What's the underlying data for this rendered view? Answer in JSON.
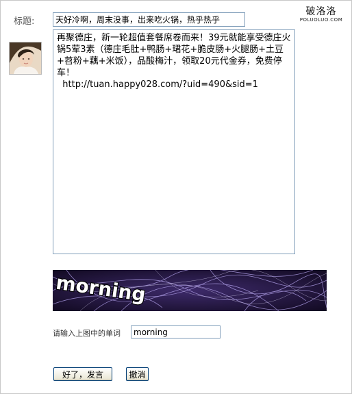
{
  "form": {
    "title_label": "标题:",
    "title_value": "天好冷啊，周末没事，出来吃火锅，热乎热乎",
    "content_text": "再聚德庄，新一轮超值套餐席卷而来！39元就能享受德庄火锅5荤3素（德庄毛肚+鸭肠+珺花+脆皮肠+火腿肠+土豆+苕粉+藕+米饭），品酸梅汁，领取20元代金券，免费停车！\n  http://tuan.happy028.com/?uid=490&sid=1",
    "captcha_word": "morning",
    "captcha_label": "请输入上图中的单词",
    "captcha_value": "morning",
    "submit_label": "好了，发言",
    "cancel_label": "撤消"
  },
  "logo": {
    "chinese": "破洛洛",
    "english": "POLUOLUO.COM"
  }
}
